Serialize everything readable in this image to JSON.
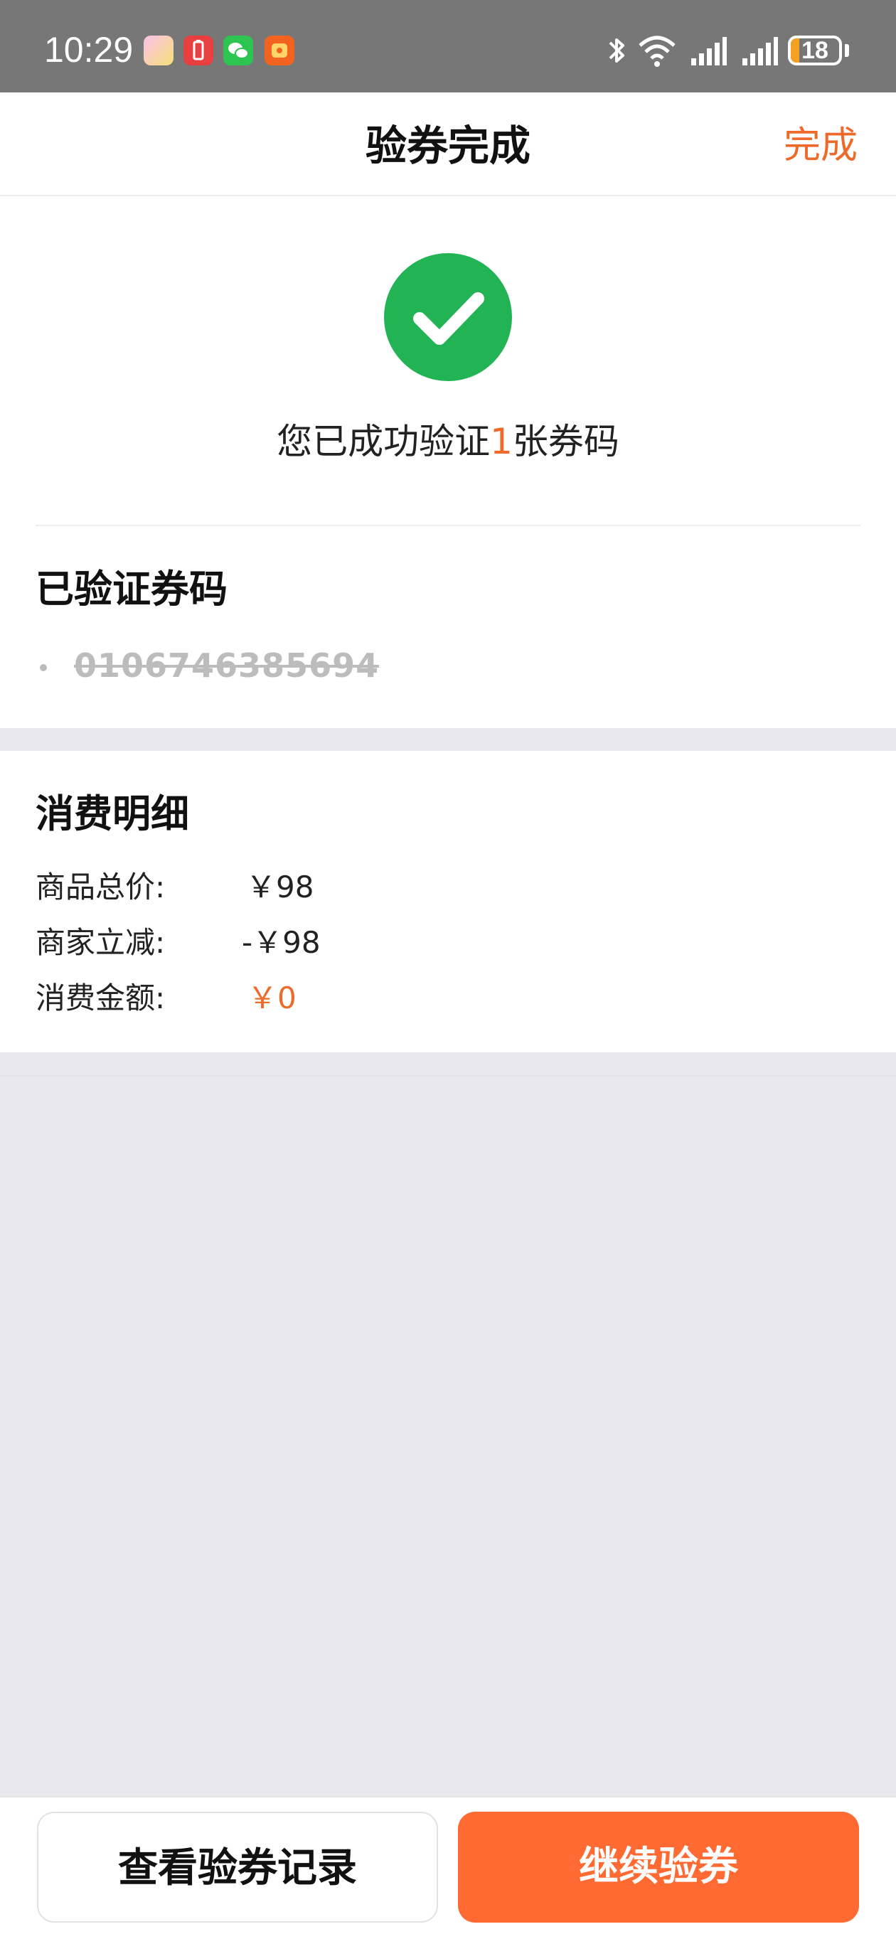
{
  "status_bar": {
    "time": "10:29",
    "battery_level": "18",
    "battery_fraction": 0.18,
    "icons": [
      "app-icon-pink",
      "battery-saver-icon",
      "wechat-icon",
      "notification-app-icon",
      "bluetooth-icon",
      "wifi-icon",
      "signal-icon",
      "signal-icon"
    ]
  },
  "nav": {
    "title": "验券完成",
    "done_label": "完成"
  },
  "result": {
    "prefix": "您已成功验证",
    "count": "1",
    "suffix": "张券码"
  },
  "verified": {
    "title": "已验证券码",
    "codes": [
      "0106746385694"
    ]
  },
  "detail": {
    "title": "消费明细",
    "rows": [
      {
        "label": "商品总价:",
        "value": "￥98"
      },
      {
        "label": "商家立减:",
        "value": "-￥98"
      },
      {
        "label": "消费金额:",
        "value": "￥0"
      }
    ]
  },
  "actions": {
    "records_label": "查看验券记录",
    "continue_label": "继续验券"
  },
  "colors": {
    "accent": "#ee6a2a",
    "success": "#22b355",
    "primary_button": "#ff6a33",
    "status_bar": "#777777"
  }
}
